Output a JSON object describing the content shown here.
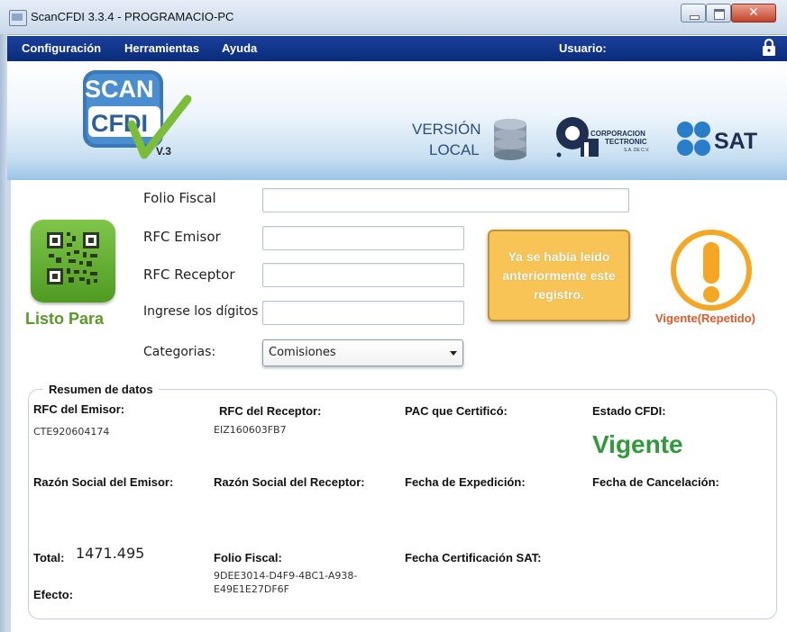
{
  "window": {
    "title": "ScanCFDI 3.3.4 - PROGRAMACIO-PC",
    "close_glyph": "✕"
  },
  "menu": {
    "items": [
      "Configuración",
      "Herramientas",
      "Ayuda"
    ],
    "user_label": "Usuario:"
  },
  "banner": {
    "logo_line1": "SCAN",
    "logo_line2": "CFDI",
    "logo_version": "V.3",
    "local_line1": "VERSIÓN",
    "local_line2": "LOCAL",
    "corp_line1": "CORPORACION",
    "corp_line2": "TECTRONIC",
    "corp_line3": "S.A. DE C.V.",
    "sat": "SAT"
  },
  "form": {
    "folio_label": "Folio Fiscal",
    "folio_value": "",
    "rfc_emisor_label": "RFC Emisor",
    "rfc_emisor_value": "",
    "rfc_receptor_label": "RFC Receptor",
    "rfc_receptor_value": "",
    "digits_label": "Ingrese los dígitos",
    "digits_value": "",
    "category_label": "Categorias:",
    "category_value": "Comisiones"
  },
  "scanner": {
    "status": "Listo Para"
  },
  "message": "Ya se había leido anteriormente este registro.",
  "status": {
    "label": "Vigente(Repetido)"
  },
  "summary": {
    "title": "Resumen de datos",
    "rfc_emisor_h": "RFC del Emisor:",
    "rfc_emisor_v": "CTE920604174",
    "rfc_receptor_h": "RFC del Receptor:",
    "rfc_receptor_v": "EIZ160603FB7",
    "pac_h": "PAC que Certificó:",
    "estado_h": "Estado CFDI:",
    "estado_v": "Vigente",
    "rs_emisor_h": "Razón Social del Emisor:",
    "rs_receptor_h": "Razón Social del Receptor:",
    "fecha_exp_h": "Fecha de Expedición:",
    "fecha_canc_h": "Fecha de Cancelación:",
    "total_h": "Total:",
    "total_v": "1471.495",
    "folio_h": "Folio Fiscal:",
    "folio_v1": "9DEE3014-D4F9-4BC1-A938-",
    "folio_v2": "E49E1E27DF6F",
    "fecha_cert_h": "Fecha Certificación SAT:",
    "efecto_h": "Efecto:"
  },
  "colors": {
    "menu_bg": "#0a2c7a",
    "message_bg": "#f8c456",
    "status_orange": "#f5a623",
    "vigente_green": "#2e9a3a",
    "qr_green": "#5aa62a"
  }
}
